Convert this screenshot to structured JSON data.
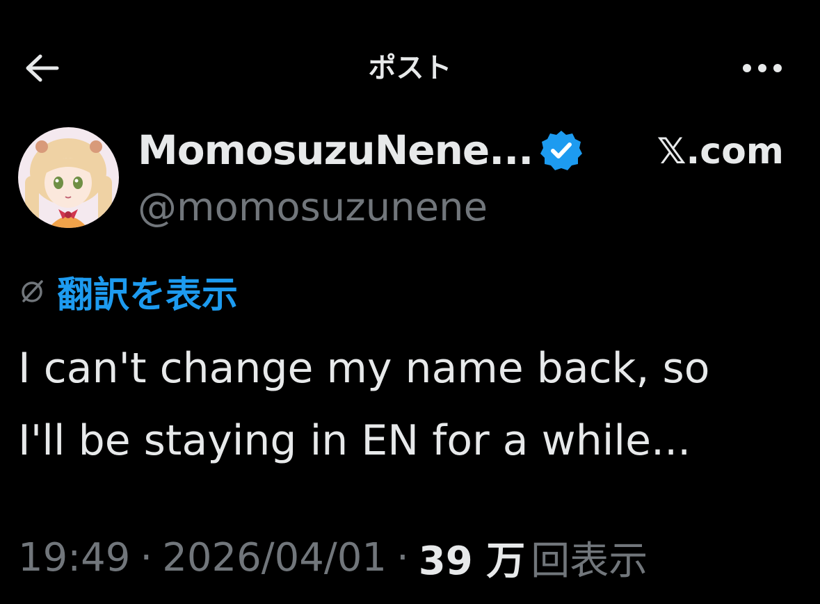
{
  "header": {
    "title": "ポスト",
    "back_icon": "arrow-left-icon",
    "more_icon": "more-horizontal-icon"
  },
  "author": {
    "display_name": "MomosuzuNene...",
    "handle": "@momosuzunene",
    "verified_icon": "verified-badge-icon",
    "source": "𝕏.com"
  },
  "translate": {
    "icon": "translate-globe-icon",
    "label": "翻訳を表示"
  },
  "tweet": {
    "lines": [
      "I can't change my name back, so",
      "I'll be staying in EN for a while..."
    ]
  },
  "meta": {
    "time": "19:49",
    "separator": "·",
    "date": "2026/04/01",
    "views_count": "39 万",
    "views_label": "回表示"
  },
  "colors": {
    "background": "#000000",
    "text": "#e7e9ea",
    "secondary": "#71767b",
    "accent": "#1d9bf0"
  }
}
